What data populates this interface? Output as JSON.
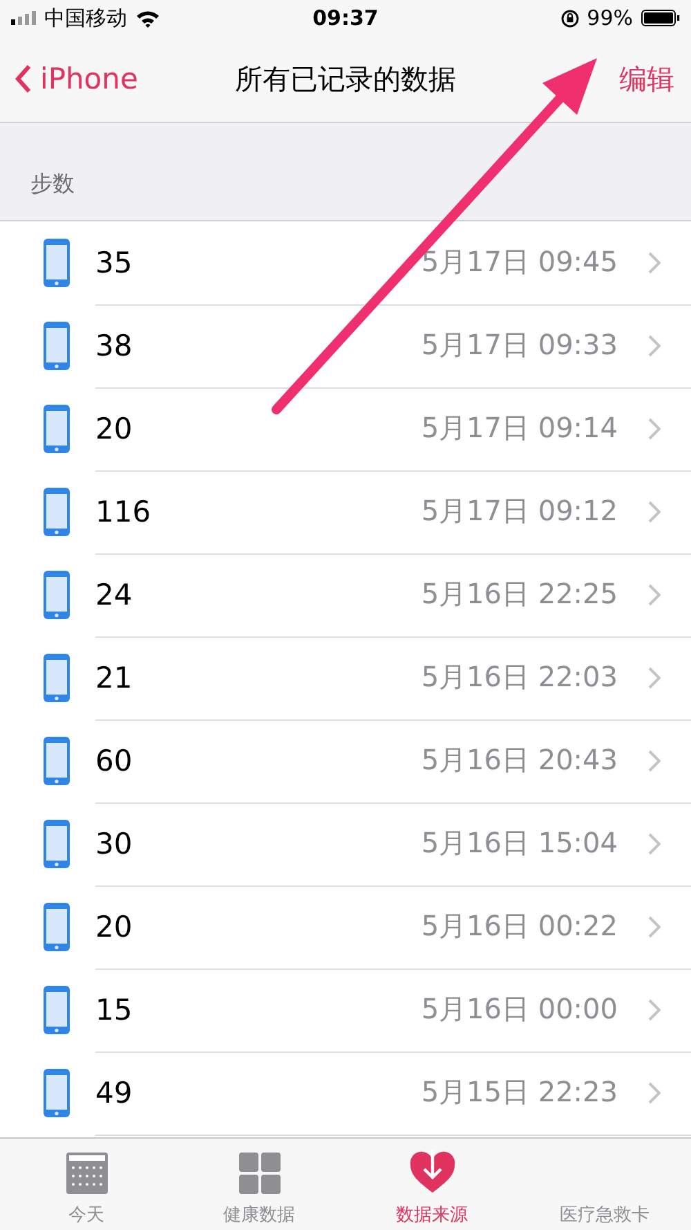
{
  "status_bar": {
    "carrier": "中国移动",
    "time": "09:37",
    "battery": "99%"
  },
  "nav": {
    "back": "iPhone",
    "title": "所有已记录的数据",
    "action": "编辑"
  },
  "section": "步数",
  "rows": [
    {
      "value": "35",
      "date": "5月17日 09:45"
    },
    {
      "value": "38",
      "date": "5月17日 09:33"
    },
    {
      "value": "20",
      "date": "5月17日 09:14"
    },
    {
      "value": "116",
      "date": "5月17日 09:12"
    },
    {
      "value": "24",
      "date": "5月16日 22:25"
    },
    {
      "value": "21",
      "date": "5月16日 22:03"
    },
    {
      "value": "60",
      "date": "5月16日 20:43"
    },
    {
      "value": "30",
      "date": "5月16日 15:04"
    },
    {
      "value": "20",
      "date": "5月16日 00:22"
    },
    {
      "value": "15",
      "date": "5月16日 00:00"
    },
    {
      "value": "49",
      "date": "5月15日 22:23"
    }
  ],
  "tabs": [
    {
      "kind": "today",
      "label": "今天",
      "selected": false
    },
    {
      "kind": "health",
      "label": "健康数据",
      "selected": false
    },
    {
      "kind": "sources",
      "label": "数据来源",
      "selected": true
    },
    {
      "kind": "medical",
      "label": "医疗急救卡",
      "selected": false
    }
  ]
}
